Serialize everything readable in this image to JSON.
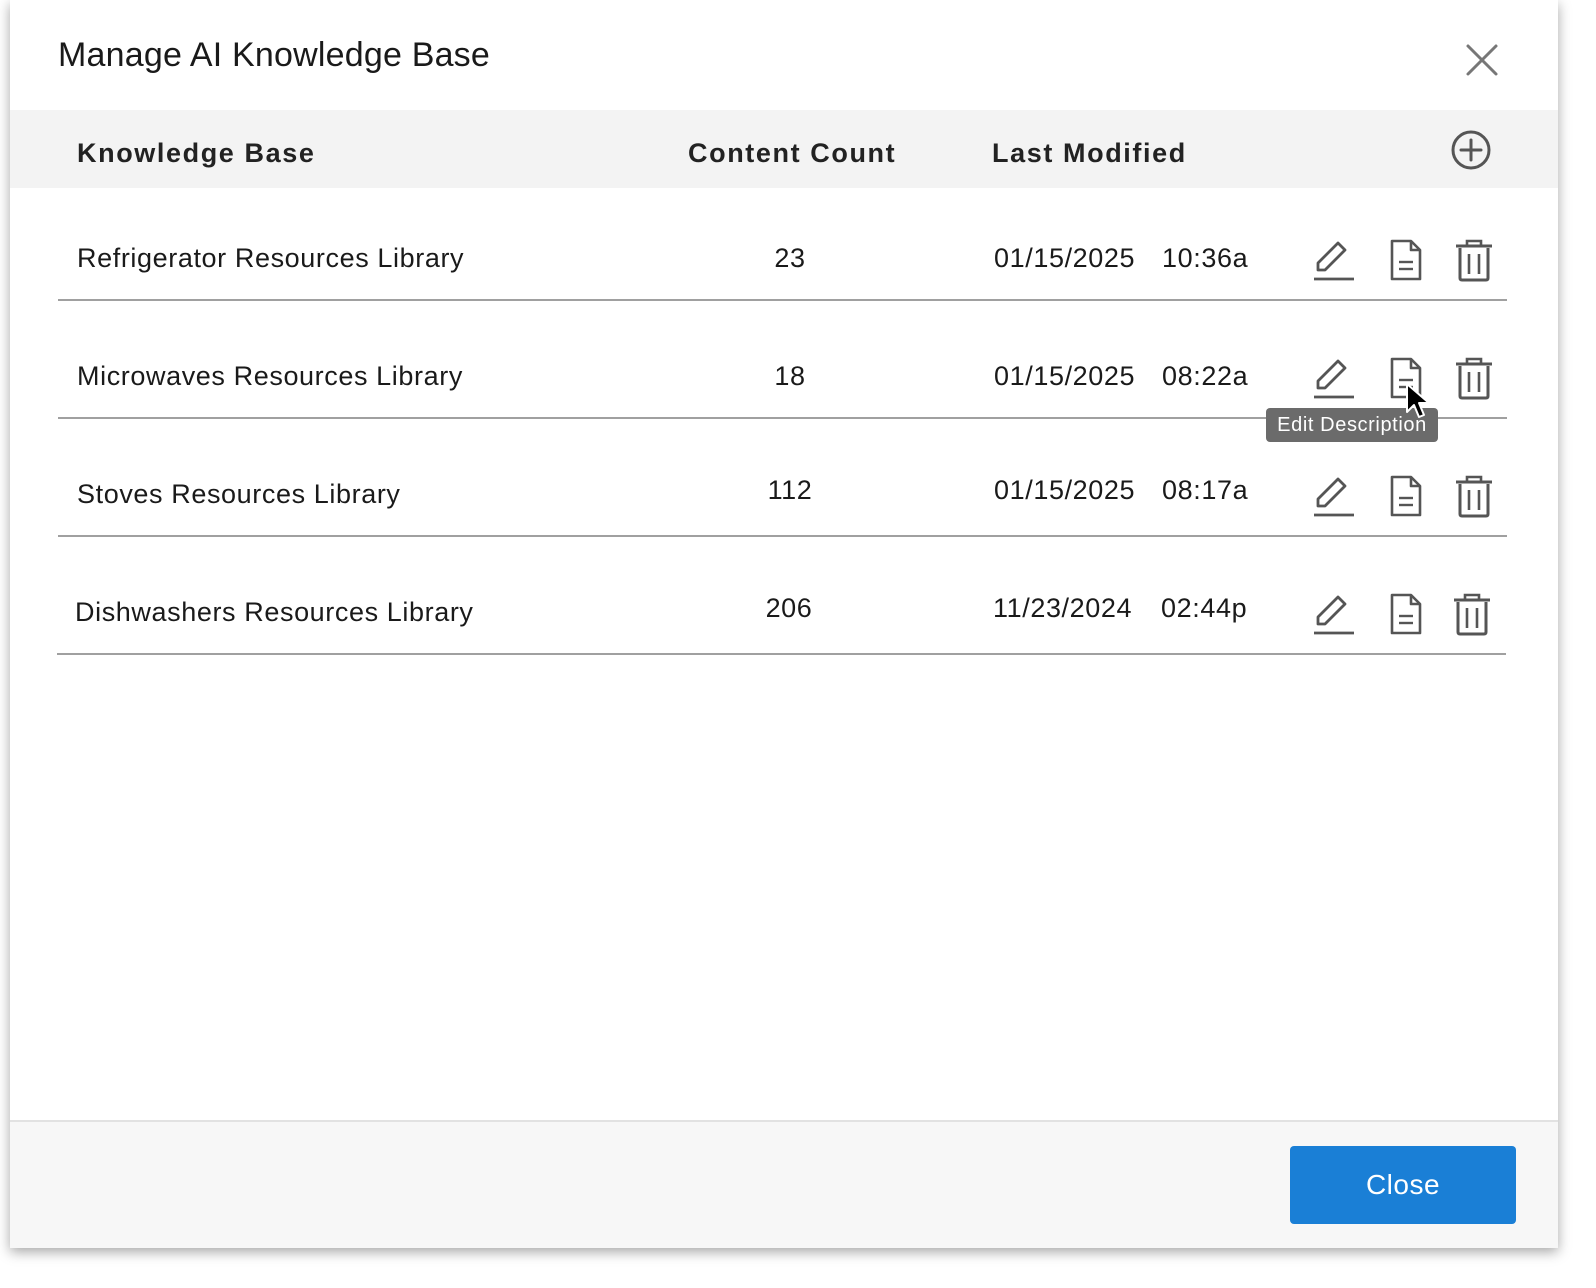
{
  "dialog": {
    "title": "Manage AI Knowledge Base",
    "close_icon": "close-icon"
  },
  "table": {
    "headers": {
      "name": "Knowledge Base",
      "count": "Content Count",
      "modified": "Last Modified"
    },
    "add_icon": "add-circle-icon",
    "rows": [
      {
        "name": "Refrigerator Resources Library",
        "count": "23",
        "date": "01/15/2025",
        "time": "10:36a"
      },
      {
        "name": "Microwaves Resources Library",
        "count": "18",
        "date": "01/15/2025",
        "time": "08:22a"
      },
      {
        "name": "Stoves Resources Library",
        "count": "112",
        "date": "01/15/2025",
        "time": "08:17a"
      },
      {
        "name": "Dishwashers Resources Library",
        "count": "206",
        "date": "11/23/2024",
        "time": "02:44p"
      }
    ],
    "row_icons": [
      "edit-pencil-icon",
      "document-icon",
      "trash-icon"
    ]
  },
  "tooltip": {
    "text": "Edit Description"
  },
  "footer": {
    "close_label": "Close"
  },
  "colors": {
    "primary_button": "#1a7fd6",
    "icon": "#555555",
    "header_bg": "#f3f3f3"
  }
}
